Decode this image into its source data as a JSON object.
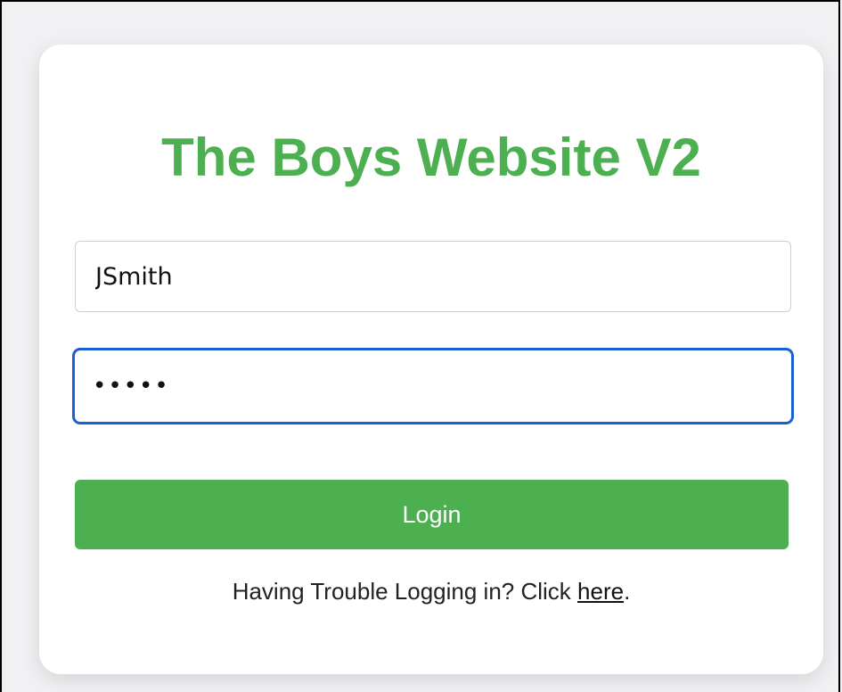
{
  "page": {
    "title": "The Boys Website V2"
  },
  "form": {
    "username_value": "JSmith",
    "password_value": "12345",
    "login_label": "Login",
    "trouble_text": "Having Trouble Logging in? Click ",
    "trouble_link": "here",
    "trouble_suffix": "."
  },
  "colors": {
    "accent": "#4caf50",
    "focus": "#1a5fd6"
  }
}
